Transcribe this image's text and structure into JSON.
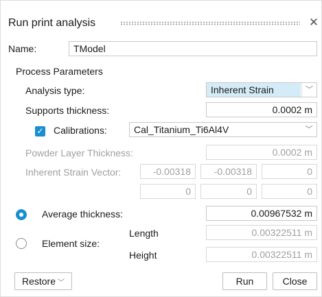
{
  "dialog": {
    "title": "Run print analysis",
    "close_glyph": "✕"
  },
  "name": {
    "label": "Name:",
    "value": "TModel"
  },
  "process": {
    "section_label": "Process Parameters",
    "analysis_type": {
      "label": "Analysis type:",
      "value": "Inherent Strain"
    },
    "supports_thickness": {
      "label": "Supports thickness:",
      "value": "0.0002 m"
    },
    "calibrations": {
      "label": "Calibrations:",
      "value": "Cal_Titanium_Ti6Al4V",
      "checked": true
    },
    "powder_layer": {
      "label": "Powder Layer Thickness:",
      "value": "0.0002 m"
    },
    "strain_vector": {
      "label": "Inherent Strain Vector:",
      "row1": [
        "-0.00318",
        "-0.00318",
        "0"
      ],
      "row2": [
        "0",
        "0",
        "0"
      ]
    },
    "average_thickness": {
      "label": "Average thickness:",
      "value": "0.00967532 m",
      "selected": true
    },
    "element_size": {
      "label": "Element size:",
      "selected": false,
      "length_label": "Length",
      "length_value": "0.00322511 m",
      "height_label": "Height",
      "height_value": "0.00322511 m"
    }
  },
  "footer": {
    "restore_label": "Restore",
    "run_label": "Run",
    "close_label": "Close"
  },
  "colors": {
    "accent": "#1a8fd0",
    "highlight": "#d4ecf7",
    "disabled_text": "#a0a0a0"
  },
  "icons": {
    "close": "close-icon",
    "dropdown": "chevron-down-icon",
    "check": "checkmark-icon"
  }
}
